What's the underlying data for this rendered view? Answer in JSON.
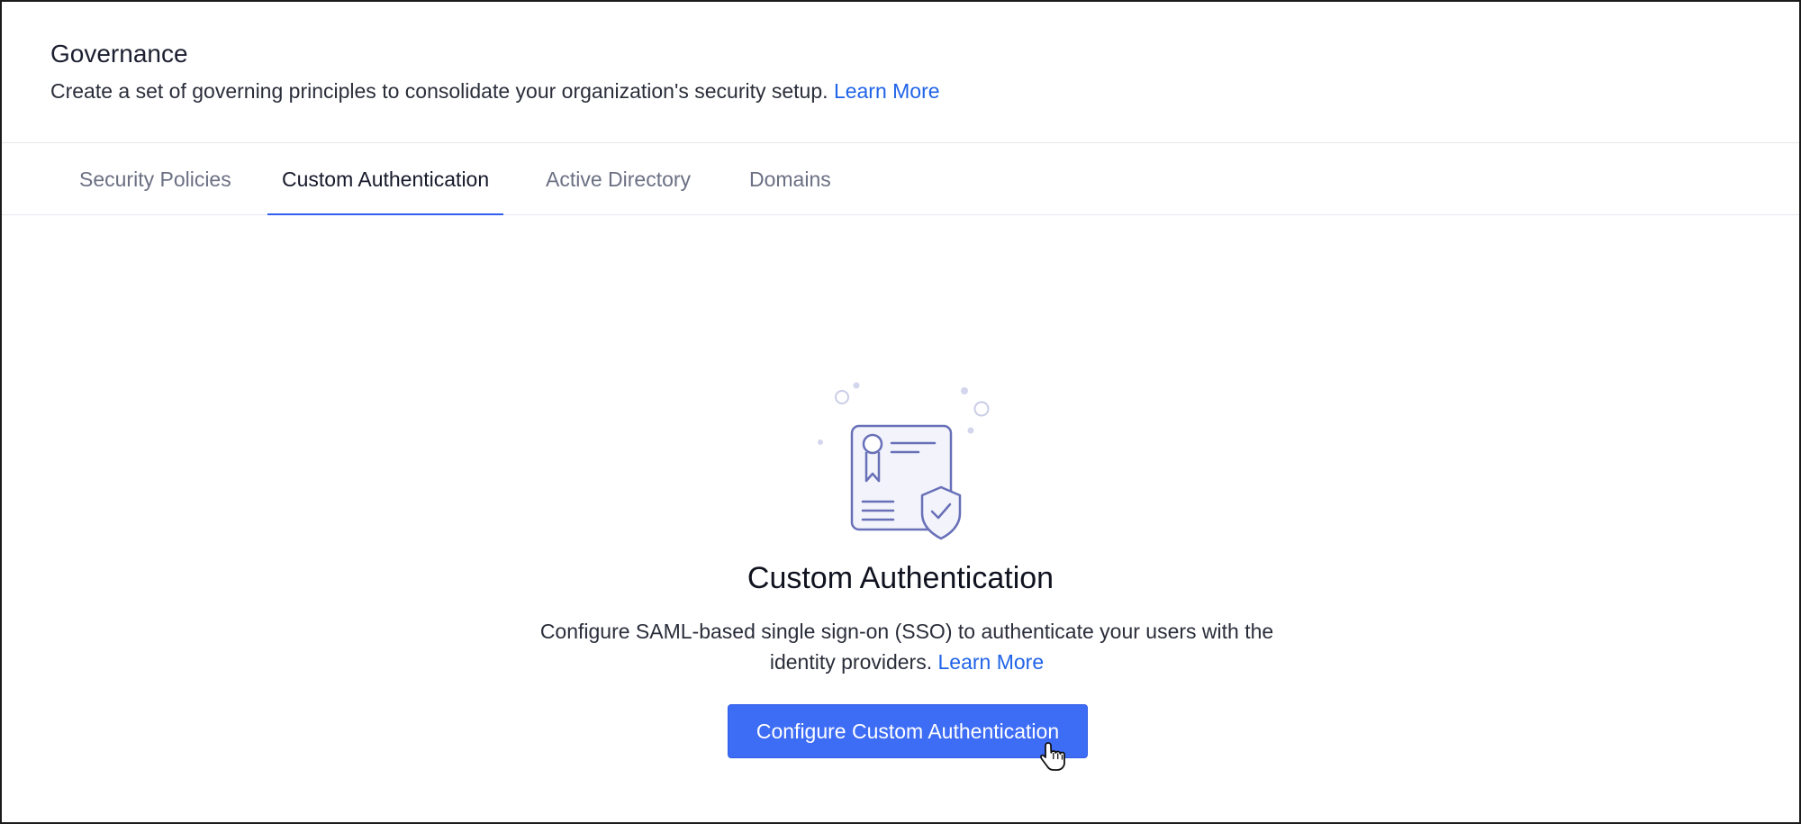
{
  "header": {
    "title": "Governance",
    "description": "Create a set of governing principles to consolidate your organization's security setup.",
    "learn_more": "Learn More"
  },
  "tabs": [
    {
      "label": "Security Policies",
      "active": false
    },
    {
      "label": "Custom Authentication",
      "active": true
    },
    {
      "label": "Active Directory",
      "active": false
    },
    {
      "label": "Domains",
      "active": false
    }
  ],
  "main": {
    "illustration_icon": "certificate-shield-icon",
    "title": "Custom Authentication",
    "description": "Configure SAML-based single sign-on (SSO) to authenticate your users with the identity providers.",
    "learn_more": "Learn More",
    "button_label": "Configure Custom Authentication"
  },
  "colors": {
    "accent": "#3d6cf5",
    "link": "#1f63e8",
    "illustration_stroke": "#6870b8"
  },
  "cursor_icon": "hand-pointer-icon"
}
